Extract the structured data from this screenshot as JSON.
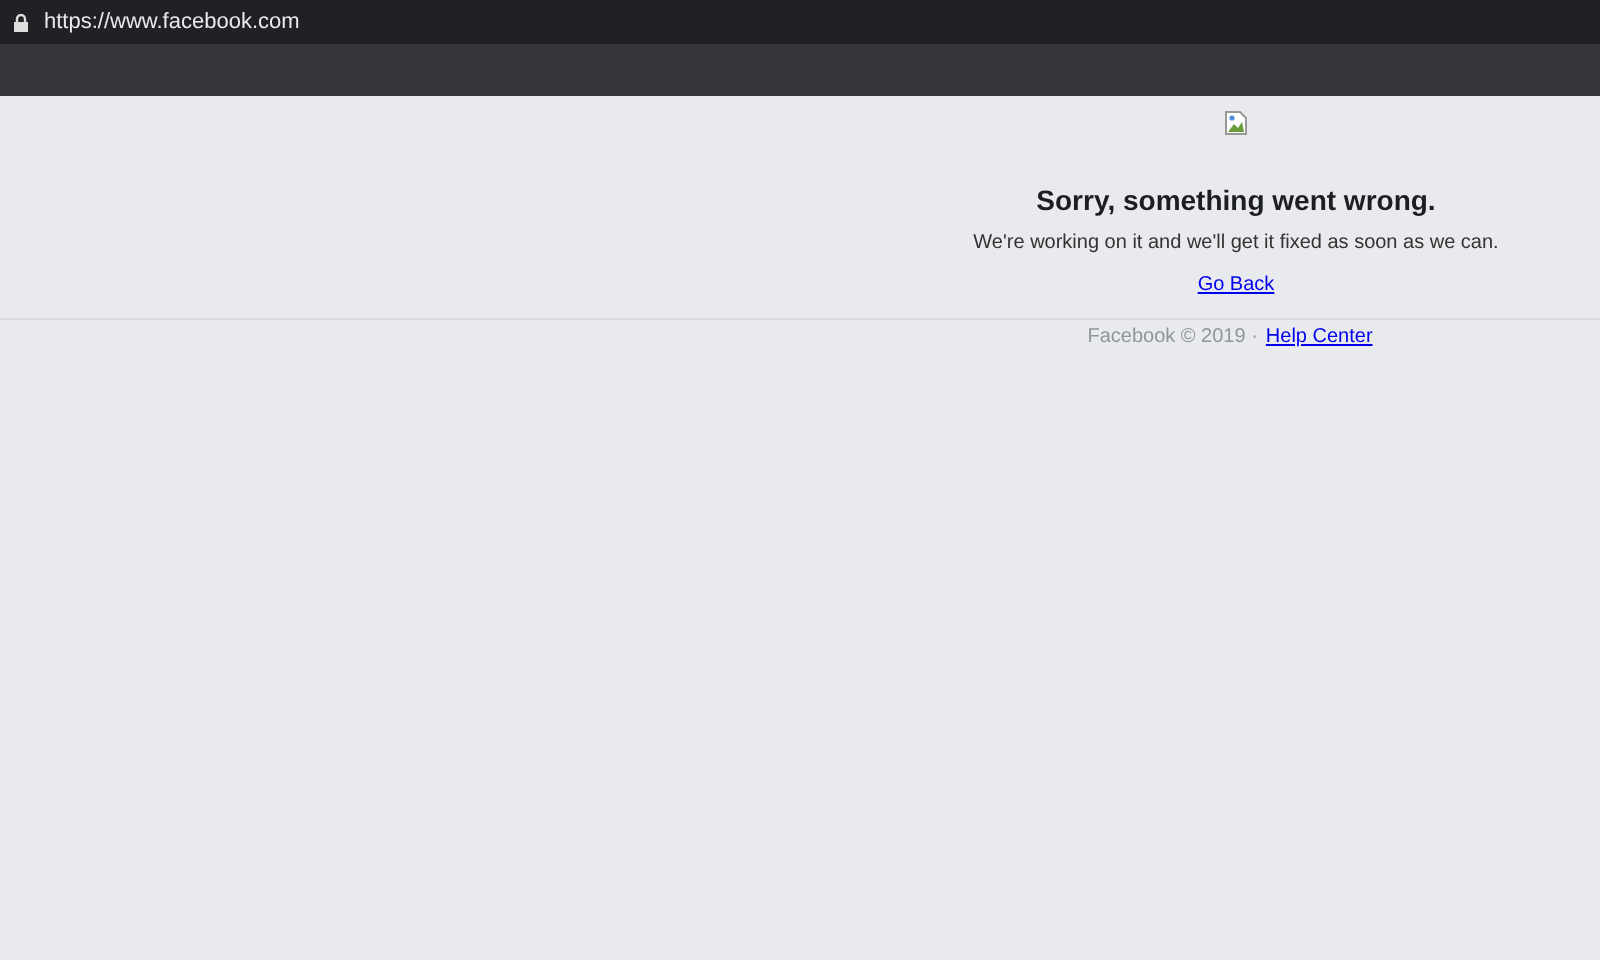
{
  "address_bar": {
    "url": "https://www.facebook.com",
    "secure": true
  },
  "error": {
    "heading": "Sorry, something went wrong.",
    "message": "We're working on it and we'll get it fixed as soon as we can.",
    "link": "Go Back"
  },
  "footer": {
    "copyright": "Facebook © 2019 ·",
    "link": "Help Center"
  }
}
